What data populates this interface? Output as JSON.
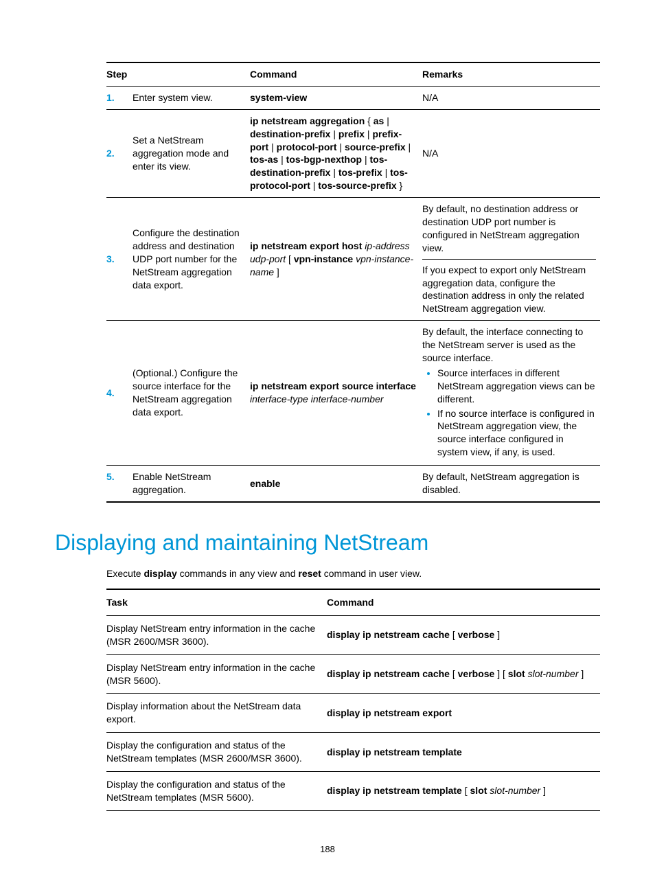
{
  "table1": {
    "headers": {
      "step": "Step",
      "command": "Command",
      "remarks": "Remarks"
    },
    "rows": [
      {
        "num": "1.",
        "step_plain": "Enter system view.",
        "cmd_bold": "system-view",
        "rem_plain": "N/A"
      },
      {
        "num": "2.",
        "step_plain": "Set a NetStream aggregation mode and enter its view.",
        "cmd_b1": "ip netstream aggregation",
        "cmd_p1": " { ",
        "cmd_b2": "as",
        "cmd_p2": " | ",
        "cmd_b3": "destination-prefix",
        "cmd_p3": " | ",
        "cmd_b4": "prefix",
        "cmd_p4": " | ",
        "cmd_b5": "prefix-port",
        "cmd_p5": " | ",
        "cmd_b6": "protocol-port",
        "cmd_p6": " | ",
        "cmd_b7": "source-prefix",
        "cmd_p7": " | ",
        "cmd_b8": "tos-as",
        "cmd_p8": " | ",
        "cmd_b9": "tos-bgp-nexthop",
        "cmd_p9": " | ",
        "cmd_b10": "tos-destination-prefix",
        "cmd_p10": " | ",
        "cmd_b11": "tos-prefix",
        "cmd_p11": " | ",
        "cmd_b12": "tos-protocol-port",
        "cmd_p12": " | ",
        "cmd_b13": "tos-source-prefix",
        "cmd_p13": " }",
        "rem_plain": "N/A"
      },
      {
        "num": "3.",
        "step_plain": "Configure the destination address and destination UDP port number for the NetStream aggregation data export.",
        "cmd_b1": "ip netstream export host",
        "cmd_i1": " ip-address udp-port",
        "cmd_p1": " [ ",
        "cmd_b2": "vpn-instance",
        "cmd_i2": " vpn-instance-name",
        "cmd_p2": " ]",
        "rem1": "By default, no destination address or destination UDP port number is configured in NetStream aggregation view.",
        "rem2": "If you expect to export only NetStream aggregation data, configure the destination address in only the related NetStream aggregation view."
      },
      {
        "num": "4.",
        "step_plain": "(Optional.) Configure the source interface for the NetStream aggregation data export.",
        "cmd_b1": "ip netstream export source interface",
        "cmd_i1": " interface-type interface-number",
        "rem1": "By default, the interface connecting to the NetStream server is used as the source interface.",
        "bullet1": "Source interfaces in different NetStream aggregation views can be different.",
        "bullet2": "If no source interface is configured in NetStream aggregation view, the source interface configured in system view, if any, is used."
      },
      {
        "num": "5.",
        "step_plain": "Enable NetStream aggregation.",
        "cmd_bold": "enable",
        "rem_plain": "By default, NetStream aggregation is disabled."
      }
    ]
  },
  "heading": "Displaying and maintaining NetStream",
  "intro_p1": "Execute ",
  "intro_b1": "display",
  "intro_p2": " commands in any view and ",
  "intro_b2": "reset",
  "intro_p3": " command in user view.",
  "table2": {
    "headers": {
      "task": "Task",
      "command": "Command"
    },
    "rows": [
      {
        "task": "Display NetStream entry information in the cache (MSR 2600/MSR 3600).",
        "cmd_b1": "display ip netstream cache",
        "cmd_p1": " [ ",
        "cmd_b2": "verbose",
        "cmd_p2": " ]"
      },
      {
        "task": "Display NetStream entry information in the cache (MSR 5600).",
        "cmd_b1": "display ip netstream cache",
        "cmd_p1": " [ ",
        "cmd_b2": "verbose",
        "cmd_p2": " ] [ ",
        "cmd_b3": "slot",
        "cmd_i1": " slot-number",
        "cmd_p3": " ]"
      },
      {
        "task": "Display information about the NetStream data export.",
        "cmd_b1": "display ip netstream export"
      },
      {
        "task": "Display the configuration and status of the NetStream templates (MSR 2600/MSR 3600).",
        "cmd_b1": "display ip netstream template"
      },
      {
        "task": "Display the configuration and status of the NetStream templates (MSR 5600).",
        "cmd_b1": "display ip netstream template",
        "cmd_p1": " [ ",
        "cmd_b2": "slot",
        "cmd_i1": " slot-number",
        "cmd_p2": " ]"
      }
    ]
  },
  "page_number": "188"
}
